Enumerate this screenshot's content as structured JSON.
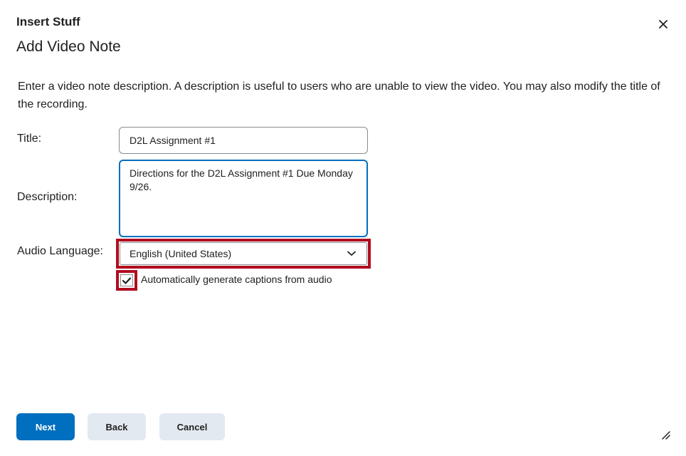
{
  "dialog": {
    "title": "Insert Stuff",
    "heading": "Add Video Note",
    "intro": "Enter a video note description. A description is useful to users who are unable to view the video. You may also modify the title of the recording."
  },
  "form": {
    "title_label": "Title:",
    "title_value": "D2L Assignment #1",
    "description_label": "Description:",
    "description_value": "Directions for the D2L Assignment #1 Due Monday 9/26.",
    "audio_language_label": "Audio Language:",
    "audio_language_value": "English (United States)",
    "captions_checked": true,
    "captions_label": "Automatically generate captions from audio"
  },
  "buttons": {
    "next": "Next",
    "back": "Back",
    "cancel": "Cancel"
  },
  "icons": {
    "close": "close-icon",
    "chevron": "chevron-down-icon",
    "check": "check-icon",
    "resize": "resize-handle-icon"
  },
  "colors": {
    "primary": "#006fbf",
    "highlight": "#b10d1f",
    "secondary_button": "#e3e9f1"
  }
}
